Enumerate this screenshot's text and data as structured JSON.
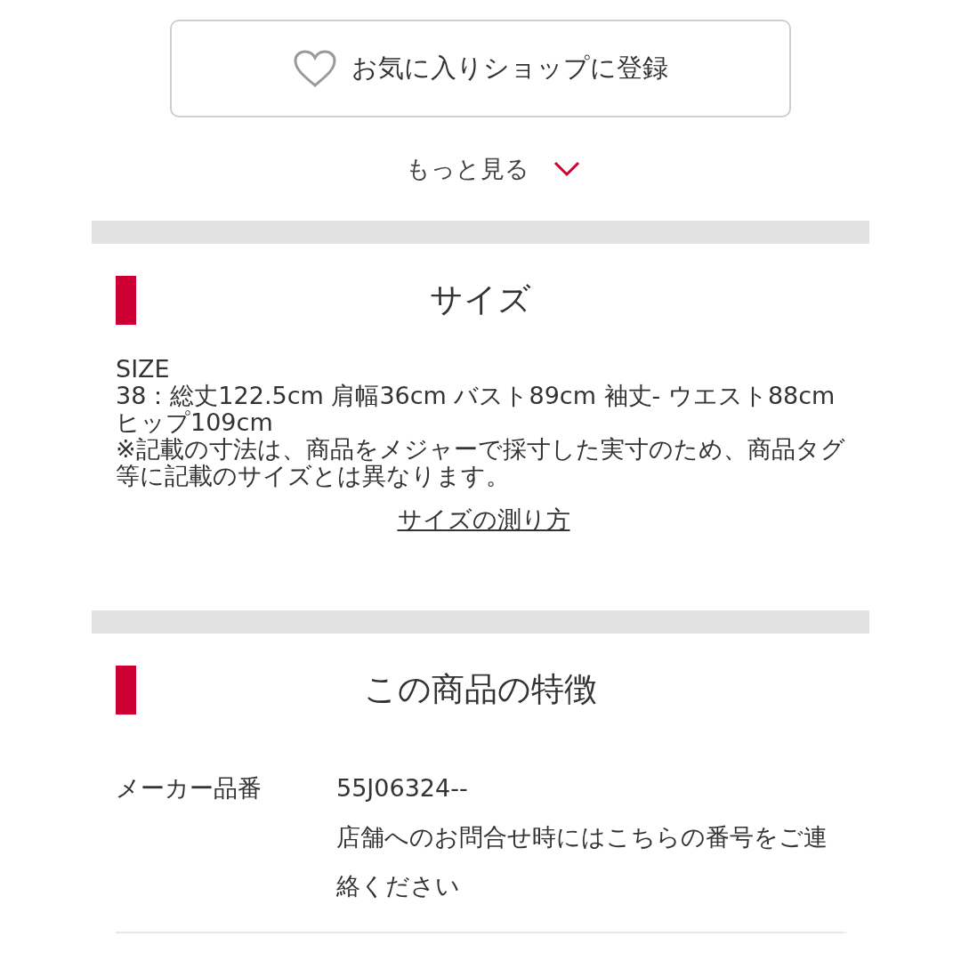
{
  "favorite_button": {
    "label": "お気に入りショップに登録"
  },
  "more_link": {
    "label": "もっと見る"
  },
  "size_section": {
    "title": "サイズ",
    "lines": [
      "SIZE",
      "38：総丈122.5cm 肩幅36cm バスト89cm 袖丈- ウエスト88cm ヒップ109cm",
      "※記載の寸法は、商品をメジャーで採寸した実寸のため、商品タグ等に記載のサイズとは異なります。"
    ],
    "link": "サイズの測り方"
  },
  "features_section": {
    "title": "この商品の特徴",
    "rows": [
      {
        "label": "メーカー品番",
        "value": "55J06324--",
        "note": "店舗へのお問合せ時にはこちらの番号をご連絡ください"
      }
    ]
  }
}
